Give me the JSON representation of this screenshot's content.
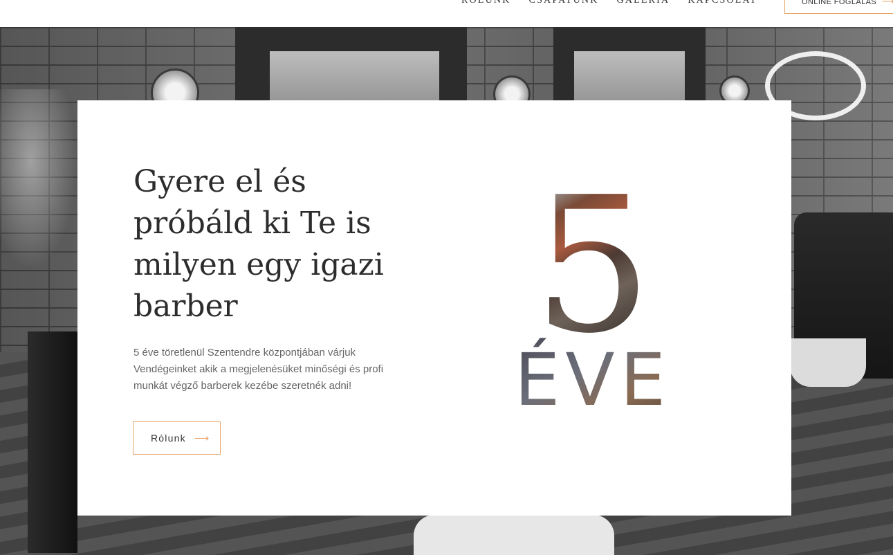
{
  "nav": {
    "items": [
      {
        "label": "RÓLUNK"
      },
      {
        "label": "CSAPATUNK"
      },
      {
        "label": "GALÉRIA"
      },
      {
        "label": "KAPCSOLAT"
      }
    ],
    "booking_label": "ONLINE FOGLALÁS",
    "booking_icon": "arrow-right-icon"
  },
  "hero": {
    "heading": "Gyere el és próbáld ki Te is milyen egy igazi barber",
    "description": "5 éve töretlenül Szentendre központjában várjuk Vendégeinket akik a megjelenésüket minőségi és profi munkát végző barberek kezébe szeretnék adni!",
    "button_label": "Rólunk",
    "button_icon": "arrow-right-icon",
    "graphic_number": "5",
    "graphic_word": "ÉVE"
  },
  "colors": {
    "accent": "#e8a56a",
    "heading_text": "#2c2c2c",
    "body_text": "#666666"
  }
}
